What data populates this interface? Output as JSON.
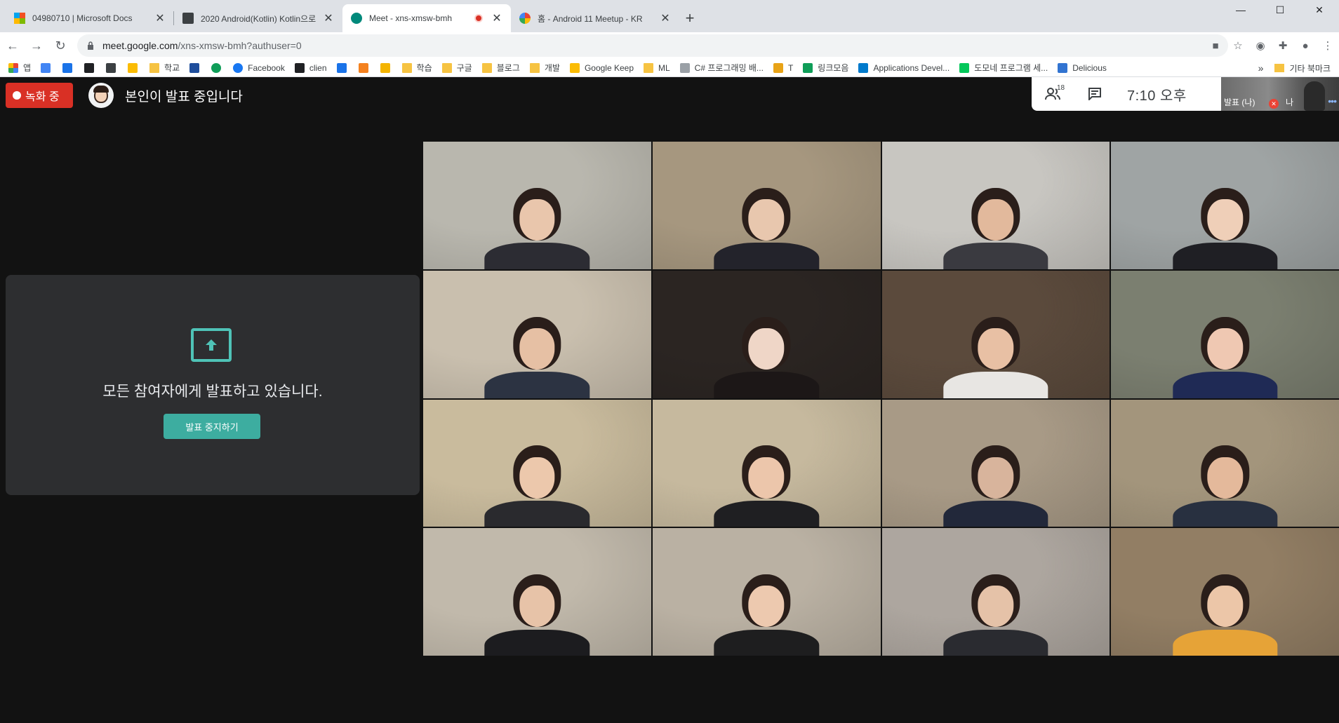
{
  "browser": {
    "tabs": [
      {
        "title": "04980710 | Microsoft Docs",
        "icon": "microsoft-icon",
        "active": false
      },
      {
        "title": "2020 Android(Kotlin) Kotlin으로",
        "icon": "classroom-icon",
        "active": false
      },
      {
        "title": "Meet - xns-xmsw-bmh",
        "icon": "meet-icon",
        "active": true,
        "recording": true
      },
      {
        "title": "홈 - Android 11 Meetup - KR",
        "icon": "google-icon",
        "active": false
      }
    ],
    "address": {
      "host": "meet.google.com",
      "path": "/xns-xmsw-bmh?authuser=0"
    },
    "bookmarks": [
      {
        "label": "앱",
        "icon": "apps-grid-icon"
      },
      {
        "label": "",
        "icon": "calendar-icon"
      },
      {
        "label": "",
        "icon": "star-bookmark-icon"
      },
      {
        "label": "",
        "icon": "notion-icon"
      },
      {
        "label": "",
        "icon": "glasses-icon"
      },
      {
        "label": "",
        "icon": "keep-icon"
      },
      {
        "label": "학교",
        "icon": "folder-icon"
      },
      {
        "label": "",
        "icon": "form-icon"
      },
      {
        "label": "",
        "icon": "globe-icon"
      },
      {
        "label": "Facebook",
        "icon": "facebook-icon"
      },
      {
        "label": "clien",
        "icon": "clien-icon"
      },
      {
        "label": "",
        "icon": "calendar24-icon"
      },
      {
        "label": "",
        "icon": "blog-icon"
      },
      {
        "label": "",
        "icon": "link-icon"
      },
      {
        "label": "학습",
        "icon": "folder-icon"
      },
      {
        "label": "구글",
        "icon": "folder-icon"
      },
      {
        "label": "블로그",
        "icon": "folder-icon"
      },
      {
        "label": "개발",
        "icon": "folder-icon"
      },
      {
        "label": "Google Keep",
        "icon": "keep-icon"
      },
      {
        "label": "ML",
        "icon": "folder-icon"
      },
      {
        "label": "C# 프로그래밍 배...",
        "icon": "doc-icon"
      },
      {
        "label": "T",
        "icon": "check-icon"
      },
      {
        "label": "링크모음",
        "icon": "plus-green-icon"
      },
      {
        "label": "Applications Devel...",
        "icon": "vscode-icon"
      },
      {
        "label": "도모네 프로그램 세...",
        "icon": "naver-icon"
      },
      {
        "label": "Delicious",
        "icon": "delicious-icon"
      }
    ],
    "bookmarks_overflow": "»",
    "other_bookmarks": "기타 북마크",
    "window_controls": {
      "minimize": "—",
      "maximize": "☐",
      "close": "✕"
    }
  },
  "meet": {
    "recording_label": "녹화 중",
    "presenter_text": "본인이 발표 중입니다",
    "participants_count": "18",
    "time": "7:10 오후",
    "self_tile": {
      "label": "발표 (나)",
      "name": "나"
    },
    "presenting_card": {
      "message": "모든 참여자에게 발표하고 있습니다.",
      "stop_button": "발표 중지하기"
    }
  },
  "video_tiles": [
    {
      "bg": "#b9b7ae",
      "skin": "#e9c6ac",
      "shirt": "#2c2c33"
    },
    {
      "bg": "#a6977f",
      "skin": "#e8c7ae",
      "shirt": "#23232b"
    },
    {
      "bg": "#c8c6c1",
      "skin": "#e2b99c",
      "shirt": "#3a3a40"
    },
    {
      "bg": "#9fa4a4",
      "skin": "#efcfb8",
      "shirt": "#1f1f24"
    },
    {
      "bg": "#c9bfae",
      "skin": "#e6c0a4",
      "shirt": "#2c3342"
    },
    {
      "bg": "#2b2522",
      "skin": "#efd6c7",
      "shirt": "#1c1717"
    },
    {
      "bg": "#5b4a3c",
      "skin": "#e8c0a4",
      "shirt": "#e8e6e3"
    },
    {
      "bg": "#7b7f70",
      "skin": "#efc8b2",
      "shirt": "#1f2a55"
    },
    {
      "bg": "#c9bb9d",
      "skin": "#ecc8ac",
      "shirt": "#2a2a2e"
    },
    {
      "bg": "#c6b99e",
      "skin": "#ecc6ab",
      "shirt": "#1f1f22"
    },
    {
      "bg": "#a89a86",
      "skin": "#d8b49c",
      "shirt": "#22283a"
    },
    {
      "bg": "#a3957c",
      "skin": "#e4b99b",
      "shirt": "#283040"
    },
    {
      "bg": "#c1b9ab",
      "skin": "#e7c3a8",
      "shirt": "#1c1c1f"
    },
    {
      "bg": "#bab1a3",
      "skin": "#edc9af",
      "shirt": "#1e1e1f"
    },
    {
      "bg": "#ada69f",
      "skin": "#e5c2a8",
      "shirt": "#2a2b30"
    },
    {
      "bg": "#927e64",
      "skin": "#ecc6a8",
      "shirt": "#e6a337"
    }
  ]
}
